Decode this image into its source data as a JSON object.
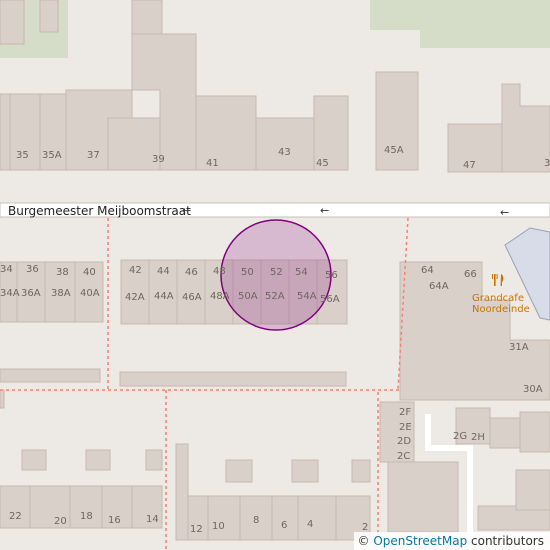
{
  "map": {
    "street_name": "Burgemeester Meijboomstraat",
    "direction_arrow": "←",
    "poi": {
      "name_line1": "Grandcafe",
      "name_line2": "Noordeinde",
      "icon": "restaurant-icon"
    },
    "house_numbers": {
      "north_row": [
        "35",
        "35A",
        "37",
        "39",
        "41",
        "43",
        "45",
        "45A",
        "47",
        "3"
      ],
      "middle_left": [
        "34",
        "36",
        "38",
        "40",
        "34A",
        "36A",
        "38A",
        "40A"
      ],
      "middle_block": [
        "42",
        "44",
        "46",
        "48",
        "50",
        "52",
        "54",
        "56",
        "42A",
        "44A",
        "46A",
        "48A",
        "50A",
        "52A",
        "54A",
        "56A"
      ],
      "east_block": [
        "64",
        "66",
        "64A",
        "31A",
        "30A",
        "2F",
        "2E",
        "2D",
        "2C",
        "2G",
        "2H"
      ],
      "south_row": [
        "22",
        "20",
        "18",
        "16",
        "14",
        "12",
        "10",
        "8",
        "6",
        "4",
        "2"
      ]
    },
    "colors": {
      "land": "#ede9e4",
      "building": "#d9d0c9",
      "building_outline": "#c6b9ae",
      "green": "#d5dcc8",
      "footpath": "#fa8072",
      "highlight_circle": "#800080"
    }
  },
  "attribution": {
    "symbol": "©",
    "link_text": "OpenStreetMap",
    "suffix": "contributors"
  }
}
